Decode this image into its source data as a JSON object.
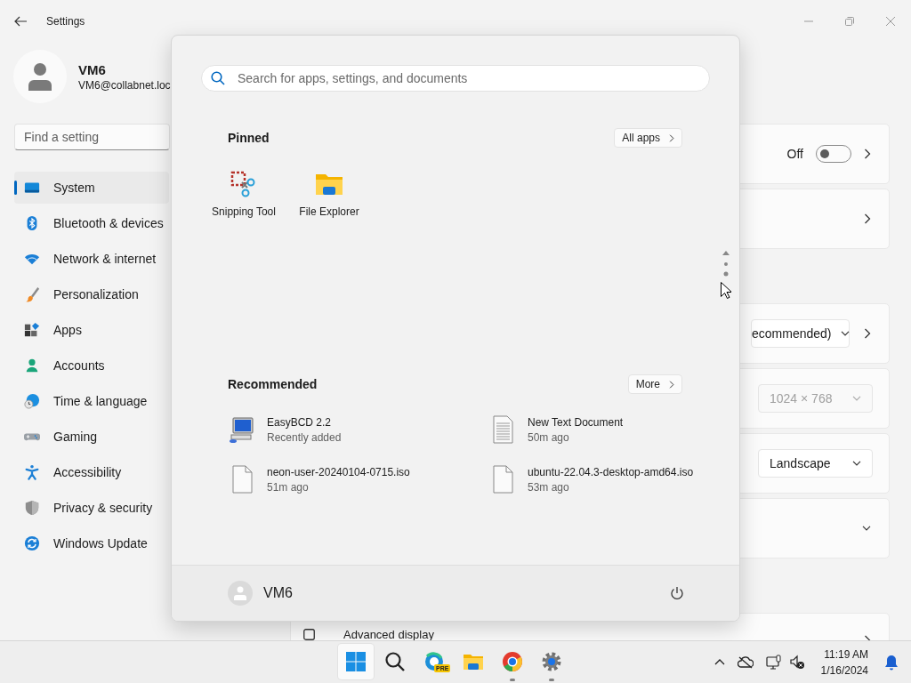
{
  "window": {
    "title": "Settings"
  },
  "account": {
    "name": "VM6",
    "email": "VM6@collabnet.loc"
  },
  "search": {
    "placeholder": "Find a setting"
  },
  "sidebar": {
    "items": [
      {
        "label": "System",
        "selected": true
      },
      {
        "label": "Bluetooth & devices",
        "selected": false
      },
      {
        "label": "Network & internet",
        "selected": false
      },
      {
        "label": "Personalization",
        "selected": false
      },
      {
        "label": "Apps",
        "selected": false
      },
      {
        "label": "Accounts",
        "selected": false
      },
      {
        "label": "Time & language",
        "selected": false
      },
      {
        "label": "Gaming",
        "selected": false
      },
      {
        "label": "Accessibility",
        "selected": false
      },
      {
        "label": "Privacy & security",
        "selected": false
      },
      {
        "label": "Windows Update",
        "selected": false
      }
    ]
  },
  "content": {
    "groups": [
      {
        "cards": [
          {
            "kind": "toggle",
            "state_label": "Off",
            "on": false
          },
          {
            "kind": "link"
          }
        ]
      },
      {
        "cards": [
          {
            "kind": "dropdown_link",
            "value": "ecommended)",
            "disabled": false
          },
          {
            "kind": "dropdown",
            "value": "1024 × 768",
            "disabled": true
          },
          {
            "kind": "dropdown",
            "value": "Landscape",
            "disabled": false
          },
          {
            "kind": "expander"
          }
        ]
      },
      {
        "cards": [
          {
            "kind": "checkbox_link",
            "label": "Advanced display"
          }
        ]
      }
    ]
  },
  "start_menu": {
    "search": {
      "placeholder": "Search for apps, settings, and documents"
    },
    "pinned": {
      "title": "Pinned",
      "button": "All apps",
      "apps": [
        {
          "label": "Snipping Tool"
        },
        {
          "label": "File Explorer"
        }
      ]
    },
    "recommended": {
      "title": "Recommended",
      "button": "More",
      "items": [
        {
          "name": "EasyBCD 2.2",
          "detail": "Recently added"
        },
        {
          "name": "New Text Document",
          "detail": "50m ago"
        },
        {
          "name": "neon-user-20240104-0715.iso",
          "detail": "51m ago"
        },
        {
          "name": "ubuntu-22.04.3-desktop-amd64.iso",
          "detail": "53m ago"
        }
      ]
    },
    "user": {
      "name": "VM6"
    }
  },
  "taskbar": {
    "buttons": [
      {
        "selected": true,
        "running": false
      },
      {
        "selected": false,
        "running": false
      },
      {
        "selected": false,
        "running": false,
        "badge": "PRE"
      },
      {
        "selected": false,
        "running": false
      },
      {
        "selected": false,
        "running": true
      },
      {
        "selected": false,
        "running": true
      }
    ],
    "clock": {
      "time": "11:19 AM",
      "date": "1/16/2024"
    }
  }
}
